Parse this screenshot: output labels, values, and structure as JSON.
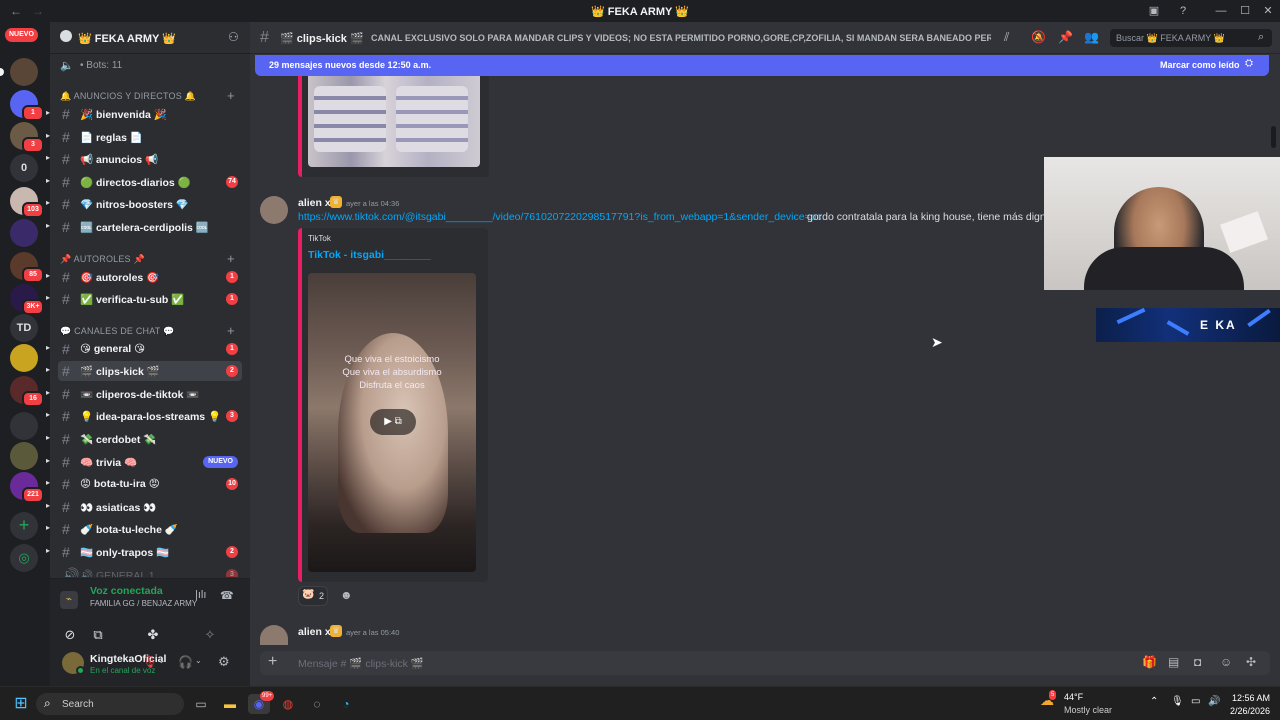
{
  "window": {
    "title": "👑 FEKA ARMY 👑"
  },
  "server": {
    "name": "👑 FEKA ARMY 👑",
    "bots_label": "• Bots: 11"
  },
  "rail": {
    "new_label": "NUEVO",
    "items": [
      {
        "label": "",
        "badge": "1"
      },
      {
        "label": "",
        "badge": "3"
      },
      {
        "label": "0",
        "badge": ""
      },
      {
        "label": "",
        "badge": "103"
      },
      {
        "label": "",
        "badge": ""
      },
      {
        "label": "",
        "badge": "85"
      },
      {
        "label": "",
        "badge": "3K+"
      },
      {
        "label": "TD",
        "badge": ""
      },
      {
        "label": "",
        "badge": ""
      },
      {
        "label": "",
        "badge": "16"
      },
      {
        "label": "",
        "badge": ""
      },
      {
        "label": "",
        "badge": ""
      },
      {
        "label": "",
        "badge": "221"
      }
    ]
  },
  "categories": {
    "anuncios": "🔔 ANUNCIOS Y DIRECTOS 🔔",
    "autoroles": "📌 AUTOROLES 📌",
    "chat": "💬 CANALES DE CHAT 💬"
  },
  "channels": [
    {
      "name": "🎉 bienvenida 🎉",
      "badge": "",
      "unread": true
    },
    {
      "name": "📄 reglas 📄",
      "badge": "",
      "unread": true
    },
    {
      "name": "📢 anuncios 📢",
      "badge": "",
      "unread": true
    },
    {
      "name": "🟢 directos-diarios 🟢",
      "badge": "74",
      "unread": true
    },
    {
      "name": "💎 nitros-boosters 💎",
      "badge": "",
      "unread": true
    },
    {
      "name": "🆒 cartelera-cerdipolis 🆒",
      "badge": "",
      "unread": true
    },
    {
      "name": "🎯 autoroles 🎯",
      "badge": "1",
      "unread": true
    },
    {
      "name": "✅ verifica-tu-sub ✅",
      "badge": "1",
      "unread": true
    },
    {
      "name": "😘 general 😘",
      "badge": "1",
      "unread": true
    },
    {
      "name": "🎬 clips-kick 🎬",
      "badge": "2",
      "unread": true
    },
    {
      "name": "📼 cliperos-de-tiktok 📼",
      "badge": "",
      "unread": true
    },
    {
      "name": "💡 idea-para-los-streams 💡",
      "badge": "3",
      "unread": true
    },
    {
      "name": "💸 cerdobet 💸",
      "badge": "",
      "unread": true
    },
    {
      "name": "🧠 trivia 🧠",
      "badge": "NUEVO",
      "unread": true
    },
    {
      "name": "😡 bota-tu-ira 😡",
      "badge": "10",
      "unread": true
    },
    {
      "name": "👀 asiaticas 👀",
      "badge": "",
      "unread": true
    },
    {
      "name": "🍼 bota-tu-leche 🍼",
      "badge": "",
      "unread": true
    },
    {
      "name": "🏳️‍⚧️ only-trapos 🏳️‍⚧️",
      "badge": "2",
      "unread": true
    },
    {
      "name": "🔊 GENERAL 1",
      "badge": "3",
      "unread": false
    }
  ],
  "voice": {
    "status": "Voz conectada",
    "channel": "FAMILIA GG / BENJAZ ARMY"
  },
  "user": {
    "name": "KingtekaOficial",
    "status": "En el canal de voz"
  },
  "header": {
    "channel": "🎬 clips-kick 🎬",
    "topic": "CANAL EXCLUSIVO SOLO PARA MANDAR CLIPS Y VIDEOS; NO ESTA PERMITIDO PORNO,GORE,CP,ZOFILIA, SI MANDAN SERA BANEADO PERMA...",
    "search_placeholder": "Buscar 👑 FEKA ARMY 👑"
  },
  "new_messages": {
    "text": "29 mensajes nuevos desde 12:50 a.m.",
    "action": "Marcar como leído"
  },
  "messages": [
    {
      "author": "alien x",
      "time": "ayer a las 04:36",
      "link": "https://www.tiktok.com/@itsgabi________/video/7610207220298517791?is_from_webapp=1&sender_device=pc",
      "text": "gordo contratala para la king house, tiene más dignid",
      "embed_provider": "TikTok",
      "embed_title": "TikTok - itsgabi________",
      "video_caption": "Que viva el estoicismo\nQue viva el absurdismo\nDisfruta el caos",
      "reaction_count": "2"
    },
    {
      "author": "alien x",
      "time": "ayer a las 05:40"
    }
  ],
  "overlay": {
    "banner_text": "E KA"
  },
  "composer": {
    "placeholder": "Mensaje # 🎬 clips-kick 🎬"
  },
  "taskbar": {
    "search": "Search",
    "weather_temp": "44°F",
    "weather_desc": "Mostly clear",
    "time": "12:56 AM",
    "date": "2/26/2026",
    "notif": "5",
    "discord_badge": "99+"
  },
  "colors": {
    "accent": "#5865f2",
    "danger": "#f23f43",
    "online": "#23a55a",
    "embed_bar": "#e91e63"
  }
}
